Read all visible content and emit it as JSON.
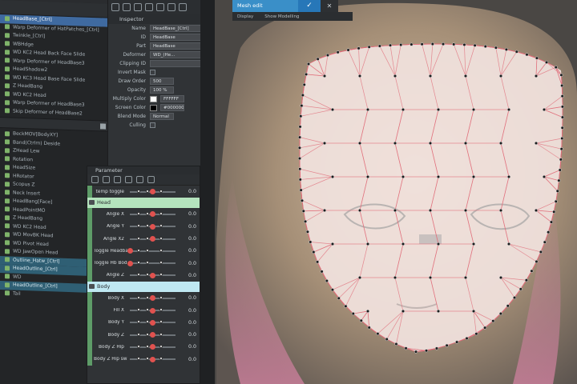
{
  "left_list": {
    "rows_top": [
      {
        "label": "HeadBase_[Ctrl]",
        "selected": true
      },
      {
        "label": "Warp Deformer of HatPatches_[Ctrl]"
      },
      {
        "label": "Twinkle_[Ctrl]"
      },
      {
        "label": "WBHdge"
      },
      {
        "label": "WD KC2 Head Back Face Slide"
      },
      {
        "label": "Warp Deformer of HeadBase3"
      },
      {
        "label": "HeadShadow2"
      },
      {
        "label": "WD KC3 Head Base Face Slide"
      },
      {
        "label": "Z HeadBang"
      },
      {
        "label": "WD KC2 Head"
      },
      {
        "label": "Warp Deformer of HeadBase3"
      },
      {
        "label": "Skip Deformer of HeadBase2"
      }
    ],
    "rows_bottom": [
      {
        "label": "BeckMOV[BodyXY]"
      },
      {
        "label": "Band(Ctrlm) Deside"
      },
      {
        "label": "ZHead Lew"
      },
      {
        "label": "Rotation"
      },
      {
        "label": "HeadSize"
      },
      {
        "label": "HRotator"
      },
      {
        "label": "Scopus Z"
      },
      {
        "label": "Neck Insert"
      },
      {
        "label": "HeadBang[Face]"
      },
      {
        "label": "HeadPointMO"
      },
      {
        "label": "Z HeadBang"
      },
      {
        "label": "WD KC2 Head"
      },
      {
        "label": "WD MovBK Head"
      },
      {
        "label": "WD Pivot Head"
      },
      {
        "label": "WD JawOpen Head"
      },
      {
        "label": "Outline_Hatw_[Ctrl]",
        "teal": true
      },
      {
        "label": "HeadOutline_[Ctrl]",
        "teal": true
      },
      {
        "label": "WD"
      },
      {
        "label": "HeadOutline_[Ctrl]",
        "teal": true
      },
      {
        "label": "Tail"
      }
    ]
  },
  "inspector": {
    "title": "Inspector",
    "name_label": "Name",
    "name_value": "HeadBase_[Ctrl]",
    "id_label": "ID",
    "id_value": "HeadBase",
    "part_label": "Part",
    "part_value": "HeadBase",
    "deformer_label": "Deformer",
    "deformer_value": "WD_(He...",
    "clipping_label": "Clipping ID",
    "invert_label": "Invert Mask",
    "draw_order_label": "Draw Order",
    "draw_order_value": "500",
    "opacity_label": "Opacity",
    "opacity_value": "100 %",
    "multiply_label": "Multiply Color",
    "multiply_value": "FFFFFF",
    "screen_label": "Screen Color",
    "screen_value": "#000000",
    "blend_label": "Blend Mode",
    "blend_value": "Normal",
    "culling_label": "Culling"
  },
  "parameter": {
    "title": "Parameter",
    "rows_pre": [
      {
        "label": "temp toggle",
        "value": "0.0",
        "pos": 0.5
      }
    ],
    "group_head": "Head",
    "rows_head": [
      {
        "label": "Angle X",
        "value": "0.0",
        "pos": 0.5
      },
      {
        "label": "Angle Y",
        "value": "0.0",
        "pos": 0.5
      },
      {
        "label": "Angle X2",
        "value": "0.0",
        "pos": 0.5
      },
      {
        "label": "Toggle Headbang",
        "value": "0.0",
        "pos": 0.0
      },
      {
        "label": "Toggle Hb Body",
        "value": "0.0",
        "pos": 0.0
      },
      {
        "label": "Angle Z",
        "value": "0.0",
        "pos": 0.5
      }
    ],
    "group_body": "Body",
    "rows_body": [
      {
        "label": "Body X",
        "value": "0.0",
        "pos": 0.5
      },
      {
        "label": "Fill X",
        "value": "0.0",
        "pos": 0.5
      },
      {
        "label": "Body Y",
        "value": "0.0",
        "pos": 0.5
      },
      {
        "label": "Body Z",
        "value": "0.0",
        "pos": 0.5
      },
      {
        "label": "Body Z Hip",
        "value": "0.0",
        "pos": 0.5
      },
      {
        "label": "Body Z Hip sway",
        "value": "0.0",
        "pos": 0.5
      }
    ]
  },
  "mesh_edit": {
    "label": "Mesh edit",
    "confirm": "✓",
    "close": "✕",
    "option_a": "Display",
    "option_b": "Show Modelling"
  },
  "colors": {
    "accent": "#3a8fc8",
    "group_head": "#b4e3bd",
    "group_body": "#bfe8f2",
    "slider_knob": "#e0524f"
  }
}
